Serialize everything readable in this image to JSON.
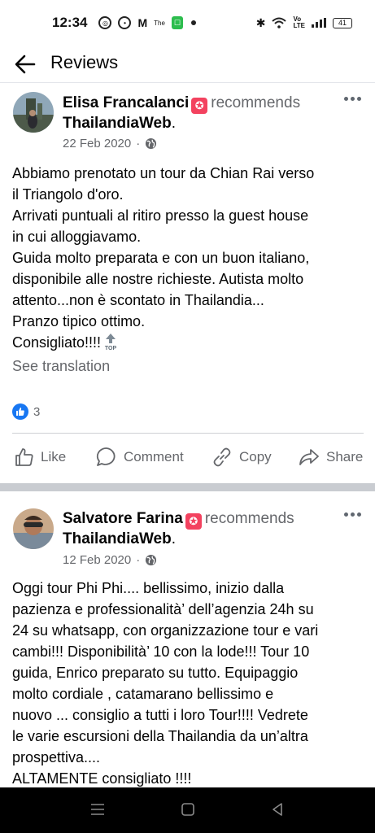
{
  "status_bar": {
    "time": "12:34",
    "battery": "41",
    "volte": "Vo\nLTE"
  },
  "header": {
    "title": "Reviews",
    "back_icon": "arrow-left-icon"
  },
  "posts": [
    {
      "author": "Elisa Francalanci",
      "recommends": "recommends",
      "page": "ThailandiaWeb",
      "date": "22 Feb 2020",
      "date_sep": "·",
      "text": "Abbiamo prenotato un tour da Chian Rai verso\nil Triangolo d'oro.\nArrivati puntuali al ritiro presso la guest house\nin cui alloggiavamo.\nGuida molto preparata e con un buon italiano,\ndisponibile alle nostre richieste. Autista molto\nattento...non è scontato in Thailandia...\nPranzo tipico ottimo.\nConsigliato!!!!",
      "see_translation": "See translation",
      "reaction_count": "3",
      "actions": [
        "Like",
        "Comment",
        "Copy",
        "Share"
      ]
    },
    {
      "author": "Salvatore Farina",
      "recommends": "recommends",
      "page": "ThailandiaWeb",
      "date": "12 Feb 2020",
      "date_sep": "·",
      "text": "Oggi tour Phi Phi.... bellissimo, inizio dalla\npazienza e professionalità’ dell’agenzia 24h su\n24 su whatsapp, con organizzazione tour e vari\ncambi!!! Disponibilità’ 10 con la lode!!! Tour 10\nguida, Enrico preparato su tutto. Equipaggio\nmolto cordiale , catamarano bellissimo e\nnuovo ... consiglio a tutti i loro Tour!!!! Vedrete\nle varie escursioni della Thailandia da un’altra\nprospettiva....\nALTAMENTE consigliato !!!!"
    }
  ],
  "colors": {
    "accent": "#1877f2",
    "badge": "#f3425f",
    "muted": "#65676b"
  }
}
